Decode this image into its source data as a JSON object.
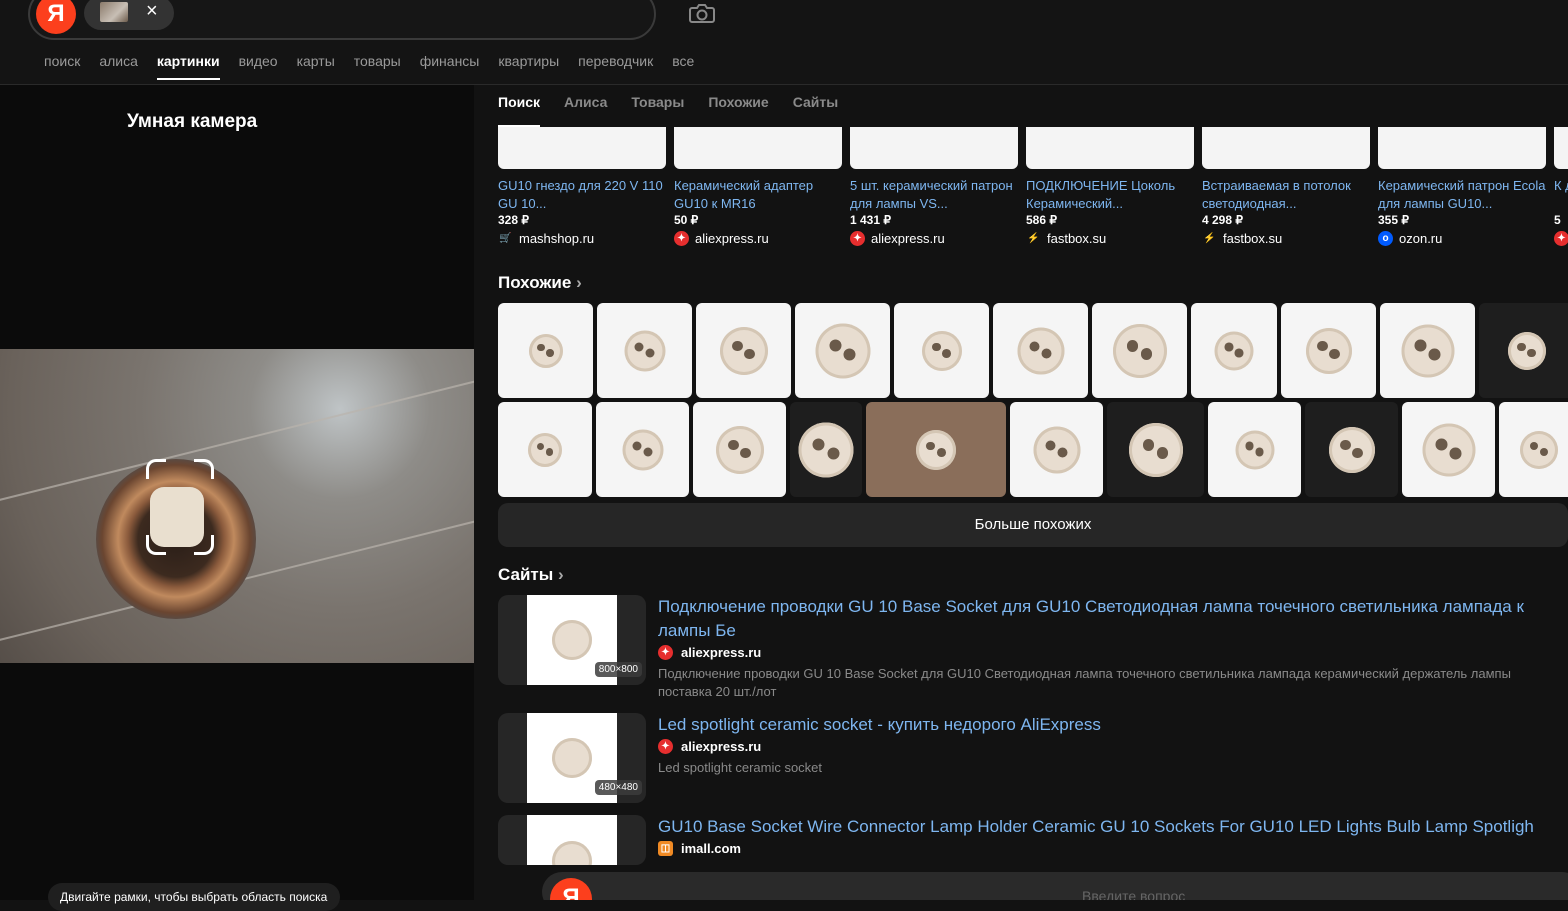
{
  "header": {
    "logo": "Я",
    "chip_close": "×",
    "services": [
      "поиск",
      "алиса",
      "картинки",
      "видео",
      "карты",
      "товары",
      "финансы",
      "квартиры",
      "переводчик",
      "все"
    ],
    "active_service": "картинки"
  },
  "left": {
    "title": "Умная камера",
    "hint": "Двигайте рамки, чтобы выбрать область поиска"
  },
  "tabs": [
    "Поиск",
    "Алиса",
    "Товары",
    "Похожие",
    "Сайты"
  ],
  "products": [
    {
      "title": "GU10 гнездо для 220 V 110 GU 10...",
      "price": "328 ₽",
      "shop": "mashshop.ru",
      "icon": "cart-icon",
      "icon_color": "#e2343b"
    },
    {
      "title": "Керамический адаптер GU10 к MR16",
      "price": "50 ₽",
      "shop": "aliexpress.ru",
      "icon": "aliexpress-icon",
      "icon_color": "#e62e2e"
    },
    {
      "title": "5 шт. керамический патрон для лампы VS...",
      "price": "1 431 ₽",
      "shop": "aliexpress.ru",
      "icon": "aliexpress-icon",
      "icon_color": "#e62e2e"
    },
    {
      "title": "ПОДКЛЮЧЕНИЕ Цоколь Керамический...",
      "price": "586 ₽",
      "shop": "fastbox.su",
      "icon": "lightning-icon",
      "icon_color": "#f5c518"
    },
    {
      "title": "Встраиваемая в потолок светодиодная...",
      "price": "4 298 ₽",
      "shop": "fastbox.su",
      "icon": "lightning-icon",
      "icon_color": "#f5c518"
    },
    {
      "title": "Керамический патрон Ecola для лампы GU10...",
      "price": "355 ₽",
      "shop": "ozon.ru",
      "icon": "ozon-icon",
      "icon_color": "#005bff"
    },
    {
      "title": "К д",
      "price": "5",
      "shop": "",
      "icon": "aliexpress-icon",
      "icon_color": "#e62e2e"
    }
  ],
  "similar": {
    "title": "Похожие",
    "more_button": "Больше похожих"
  },
  "sites": {
    "title": "Сайты",
    "items": [
      {
        "title": "Подключение проводки GU 10 Base Socket для GU10 Светодиодная лампа точечного светильника лампада к лампы Бе",
        "host": "aliexpress.ru",
        "size": "800×800",
        "desc": "Подключение проводки GU 10 Base Socket для GU10 Светодиодная лампа точечного светильника лампада керамический держатель лампы поставка 20 шт./лот"
      },
      {
        "title": "Led spotlight ceramic socket - купить недорого AliExpress",
        "host": "aliexpress.ru",
        "size": "480×480",
        "desc": "Led spotlight ceramic socket"
      },
      {
        "title": "GU10 Base Socket Wire Connector Lamp Holder Ceramic GU 10 Sockets For GU10 LED Lights Bulb Lamp Spotligh",
        "host": "imall.com",
        "size": "",
        "desc": ""
      }
    ]
  },
  "bottom": {
    "logo": "Я",
    "placeholder": "Введите вопрос"
  }
}
